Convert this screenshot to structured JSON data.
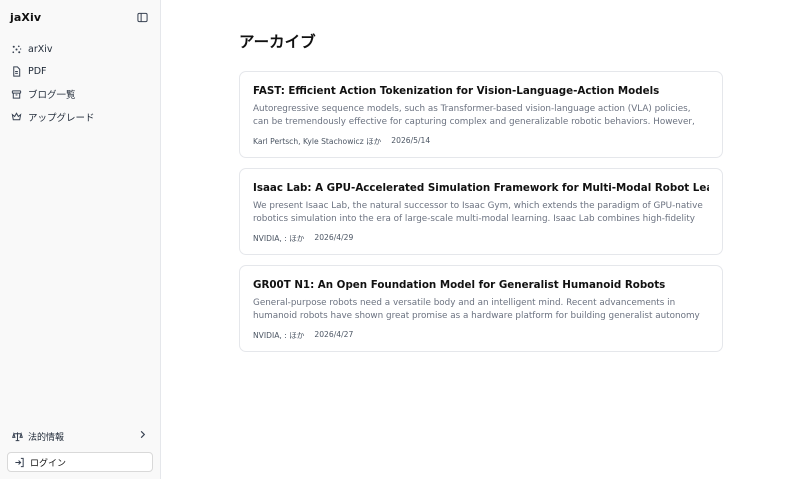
{
  "sidebar": {
    "brand": "jaXiv",
    "items": [
      {
        "label": "arXiv",
        "icon": "sparkles-icon"
      },
      {
        "label": "PDF",
        "icon": "file-icon"
      },
      {
        "label": "ブログ一覧",
        "icon": "archive-icon"
      },
      {
        "label": "アップグレード",
        "icon": "crown-icon"
      }
    ],
    "legal": {
      "label": "法的情報",
      "icon": "scale-icon"
    },
    "login": {
      "label": "ログイン",
      "icon": "login-icon"
    }
  },
  "main": {
    "title": "アーカイブ",
    "cards": [
      {
        "title": "FAST: Efficient Action Tokenization for Vision-Language-Action Models",
        "abstract": "Autoregressive sequence models, such as Transformer-based vision-language action (VLA) policies, can be tremendously effective for capturing complex and generalizable robotic behaviors. However, such models…",
        "authors": "Karl Pertsch, Kyle Stachowicz ほか",
        "date": "2026/5/14"
      },
      {
        "title": "Isaac Lab: A GPU-Accelerated Simulation Framework for Multi-Modal Robot Learning",
        "abstract": "We present Isaac Lab, the natural successor to Isaac Gym, which extends the paradigm of GPU-native robotics simulation into the era of large-scale multi-modal learning. Isaac Lab combines high-fidelity GPU…",
        "authors": "NVIDIA, : ほか",
        "date": "2026/4/29"
      },
      {
        "title": "GR00T N1: An Open Foundation Model for Generalist Humanoid Robots",
        "abstract": "General-purpose robots need a versatile body and an intelligent mind. Recent advancements in humanoid robots have shown great promise as a hardware platform for building generalist autonomy in the human…",
        "authors": "NVIDIA, : ほか",
        "date": "2026/4/27"
      }
    ]
  }
}
